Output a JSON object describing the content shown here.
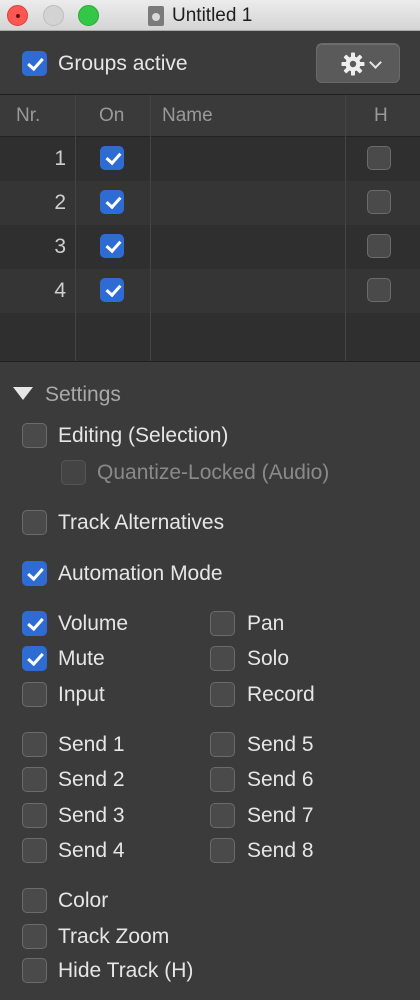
{
  "window": {
    "title": "Untitled 1"
  },
  "header": {
    "groups_active_label": "Groups active",
    "groups_active_checked": true
  },
  "table": {
    "columns": [
      "Nr.",
      "On",
      "Name",
      "H"
    ],
    "rows": [
      {
        "nr": "1",
        "on": true,
        "name": "",
        "h": false
      },
      {
        "nr": "2",
        "on": true,
        "name": "",
        "h": false
      },
      {
        "nr": "3",
        "on": true,
        "name": "",
        "h": false
      },
      {
        "nr": "4",
        "on": true,
        "name": "",
        "h": false
      }
    ]
  },
  "settings": {
    "title": "Settings",
    "editing": {
      "label": "Editing (Selection)",
      "checked": false
    },
    "quantize": {
      "label": "Quantize-Locked (Audio)",
      "checked": false,
      "disabled": true
    },
    "track_alternatives": {
      "label": "Track Alternatives",
      "checked": false
    },
    "automation_mode": {
      "label": "Automation Mode",
      "checked": true
    },
    "volume": {
      "label": "Volume",
      "checked": true
    },
    "pan": {
      "label": "Pan",
      "checked": false
    },
    "mute": {
      "label": "Mute",
      "checked": true
    },
    "solo": {
      "label": "Solo",
      "checked": false
    },
    "input": {
      "label": "Input",
      "checked": false
    },
    "record": {
      "label": "Record",
      "checked": false
    },
    "send1": {
      "label": "Send 1",
      "checked": false
    },
    "send2": {
      "label": "Send 2",
      "checked": false
    },
    "send3": {
      "label": "Send 3",
      "checked": false
    },
    "send4": {
      "label": "Send 4",
      "checked": false
    },
    "send5": {
      "label": "Send 5",
      "checked": false
    },
    "send6": {
      "label": "Send 6",
      "checked": false
    },
    "send7": {
      "label": "Send 7",
      "checked": false
    },
    "send8": {
      "label": "Send 8",
      "checked": false
    },
    "color": {
      "label": "Color",
      "checked": false
    },
    "track_zoom": {
      "label": "Track Zoom",
      "checked": false
    },
    "hide_track": {
      "label": "Hide Track (H)",
      "checked": false
    }
  },
  "icons": {
    "gear": "gear-icon",
    "menu_chevron": "chevron-down-icon",
    "document": "document-icon"
  },
  "colors": {
    "accent": "#2e6cd3",
    "panel": "#3b3b3b"
  }
}
